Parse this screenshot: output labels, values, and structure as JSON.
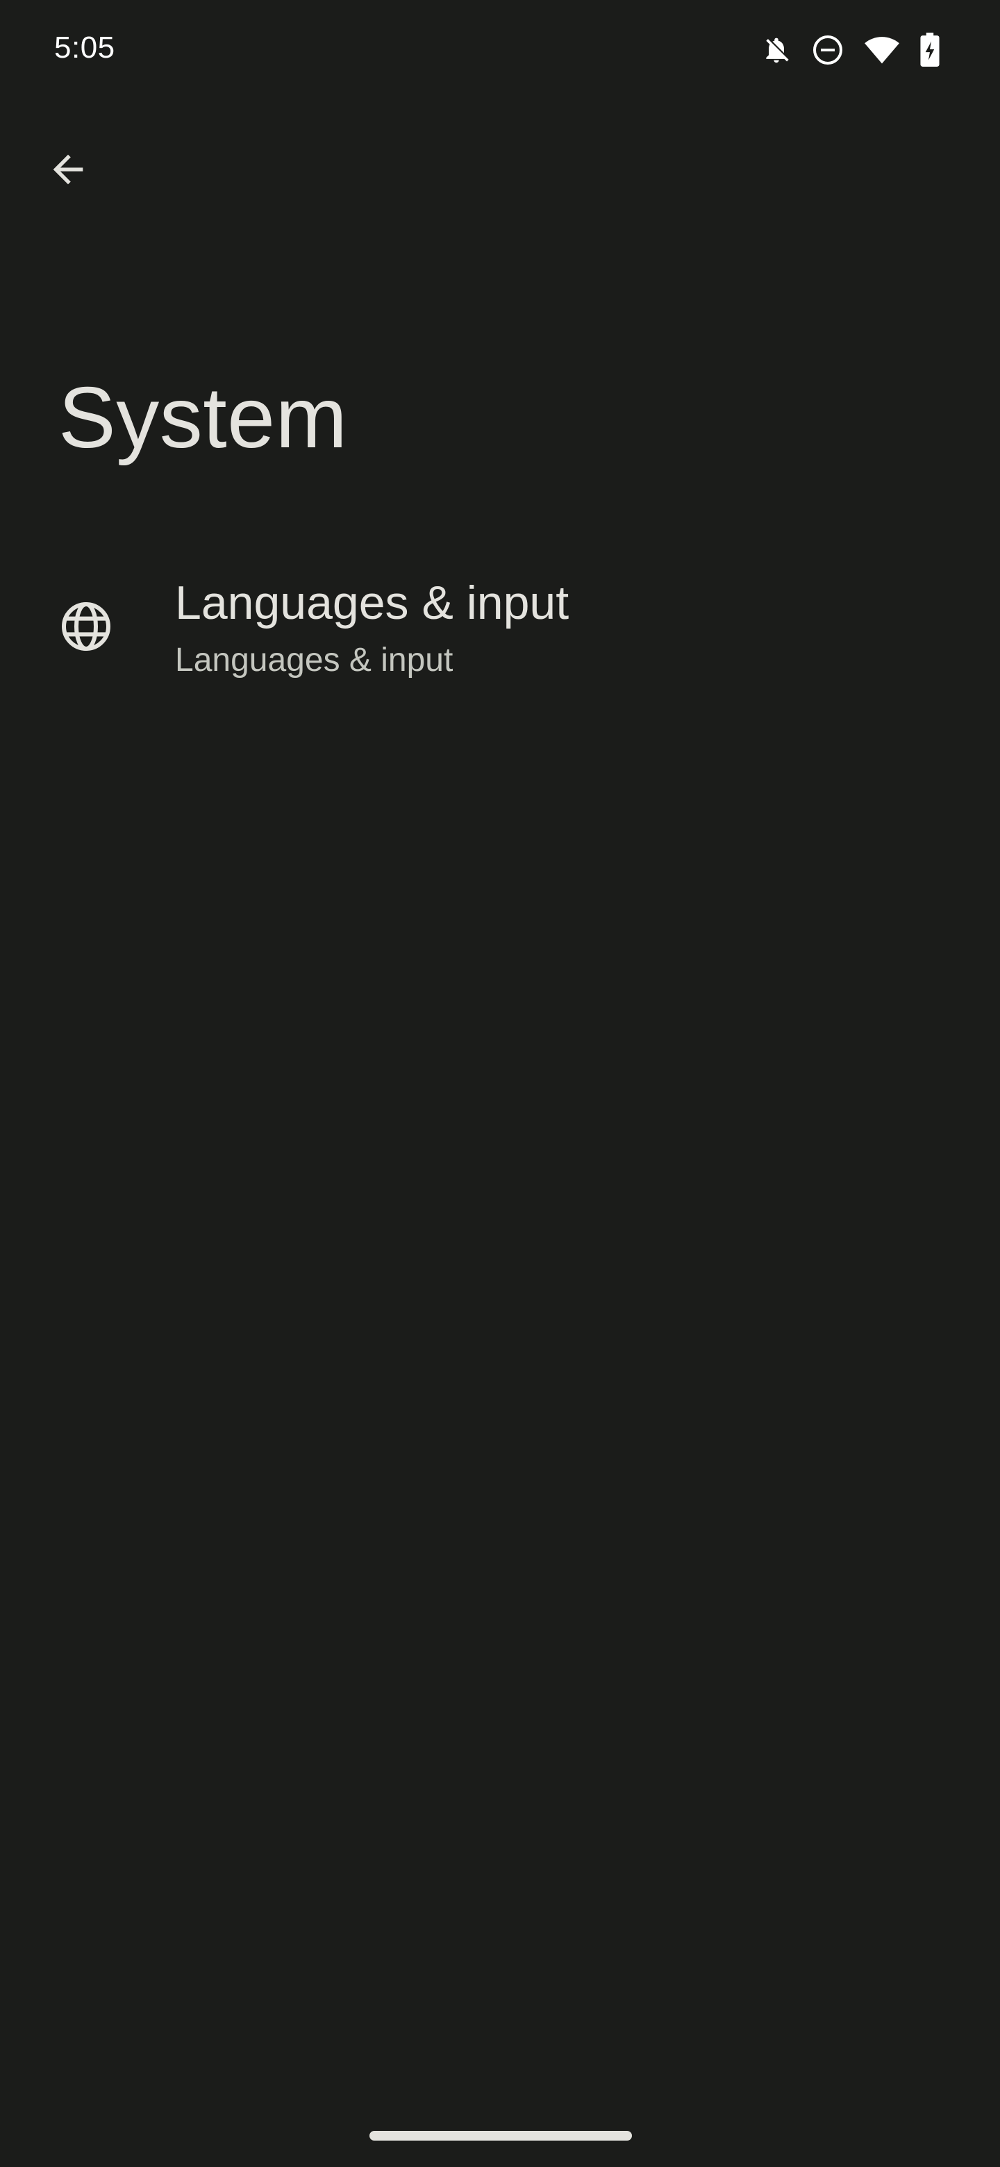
{
  "status_bar": {
    "time": "5:05",
    "icons": [
      "notifications-off-icon",
      "do-not-disturb-icon",
      "wifi-icon",
      "battery-charging-icon"
    ]
  },
  "header": {
    "back_icon": "arrow-back-icon",
    "title": "System"
  },
  "settings_items": [
    {
      "icon": "globe-icon",
      "title": "Languages & input",
      "summary": "Languages & input"
    }
  ],
  "colors": {
    "background": "#1b1c1a",
    "text_primary": "#e4e3de",
    "text_secondary": "#c4c6bf"
  }
}
